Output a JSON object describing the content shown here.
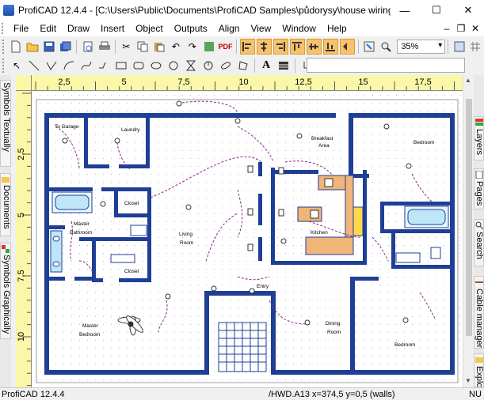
{
  "window": {
    "title": "ProfiCAD 12.4.4 - [C:\\Users\\Public\\Documents\\ProfiCAD Samples\\půdorysy\\house wiring diagram.sxe]",
    "minimize": "—",
    "maximize": "☐",
    "close": "✕"
  },
  "menu": {
    "items": [
      "File",
      "Edit",
      "Draw",
      "Insert",
      "Object",
      "Outputs",
      "Align",
      "View",
      "Window",
      "Help"
    ],
    "mdi_minimize": "–",
    "mdi_restore": "❐",
    "mdi_close": "✕"
  },
  "toolbar": {
    "zoom_value": "35%",
    "pdf_label": "PDF",
    "text_tool": "A"
  },
  "left_panels": [
    {
      "label": "Symbols Textually"
    },
    {
      "label": "Documents"
    },
    {
      "label": "Symbols Graphically"
    }
  ],
  "right_panels": [
    {
      "label": "Layers"
    },
    {
      "label": "Pages"
    },
    {
      "label": "Search"
    },
    {
      "label": "Cable manager"
    },
    {
      "label": "Explo"
    }
  ],
  "ruler": {
    "top_labels": [
      "2,5",
      "5",
      "7,5",
      "10",
      "12,5",
      "15",
      "17,5"
    ],
    "left_labels": [
      "2,5",
      "5",
      "7,5",
      "10"
    ]
  },
  "drawing": {
    "rooms": [
      "To Garage",
      "Laundry",
      "Breakfast",
      "Area",
      "Bedroom",
      "Closet",
      "Master",
      "Bathroom",
      "Living",
      "Room",
      "Kitchen",
      "Closet",
      "Entry",
      "Master",
      "Bedroom",
      "Dining",
      "Room",
      "Bedroom"
    ]
  },
  "status": {
    "app": "ProfiCAD 12.4.4",
    "info": "/HWD.A13  x=374,5  y=0,5 (walls)",
    "nu": "NU"
  },
  "colors": {
    "wall": "#1f3f96",
    "wire": "#8a2a8a",
    "kitchen": "#f1b579",
    "ruler": "#fbf7a8",
    "highlight": "#f7c26b"
  }
}
